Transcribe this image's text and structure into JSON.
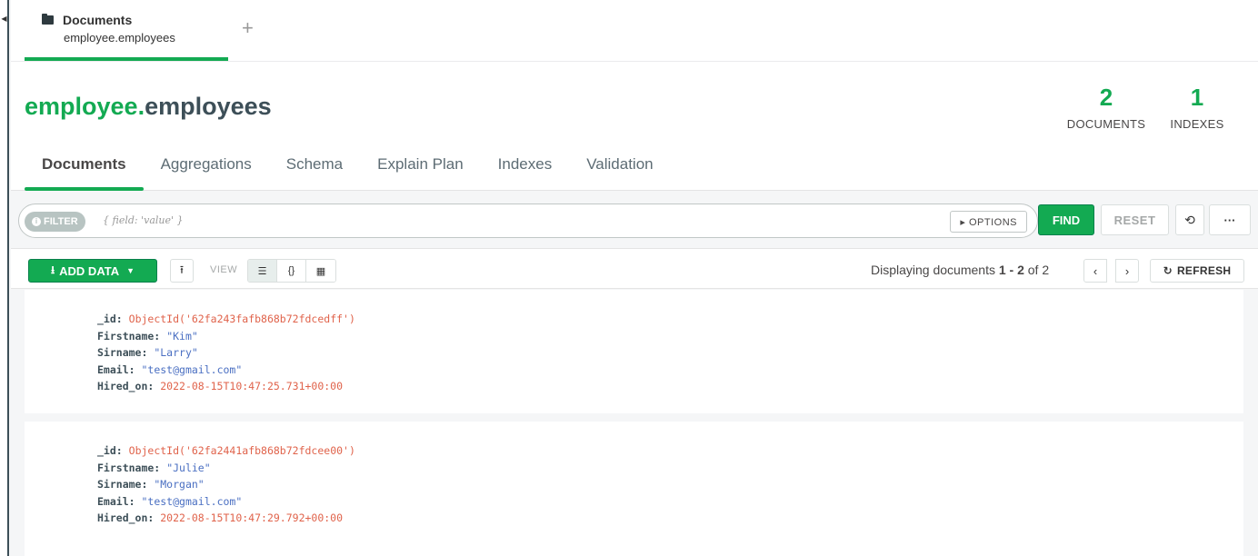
{
  "tabs": [
    {
      "title": "Documents",
      "subtitle": "employee.employees"
    }
  ],
  "add_tab_label": "+",
  "namespace": {
    "db": "employee",
    "dot": ".",
    "collection": "employees"
  },
  "stats": {
    "documents": {
      "value": "2",
      "label": "DOCUMENTS"
    },
    "indexes": {
      "value": "1",
      "label": "INDEXES"
    }
  },
  "subtabs": [
    "Documents",
    "Aggregations",
    "Schema",
    "Explain Plan",
    "Indexes",
    "Validation"
  ],
  "filter": {
    "badge": "FILTER",
    "placeholder": "{ field: 'value' }",
    "options_label": "▸ OPTIONS",
    "find_label": "FIND",
    "reset_label": "RESET",
    "more_label": "···"
  },
  "toolbar": {
    "add_data_label": "ADD DATA",
    "view_label": "VIEW",
    "displaying_prefix": "Displaying documents ",
    "range": "1 - 2",
    "of_text": " of ",
    "total": "2",
    "refresh_label": "REFRESH"
  },
  "documents": [
    {
      "id": "ObjectId('62fa243fafb868b72fdcedff')",
      "Firstname": "\"Kim\"",
      "Sirname": "\"Larry\"",
      "Email": "\"test@gmail.com\"",
      "Hired_on": "2022-08-15T10:47:25.731+00:00"
    },
    {
      "id": "ObjectId('62fa2441afb868b72fdcee00')",
      "Firstname": "\"Julie\"",
      "Sirname": "\"Morgan\"",
      "Email": "\"test@gmail.com\"",
      "Hired_on": "2022-08-15T10:47:29.792+00:00"
    }
  ],
  "field_labels": {
    "id": "_id:",
    "Firstname": "Firstname:",
    "Sirname": "Sirname:",
    "Email": "Email:",
    "Hired_on": "Hired_on:"
  },
  "colors": {
    "accent": "#13aa52",
    "oid": "#e0634b",
    "string": "#4a6fc2"
  }
}
